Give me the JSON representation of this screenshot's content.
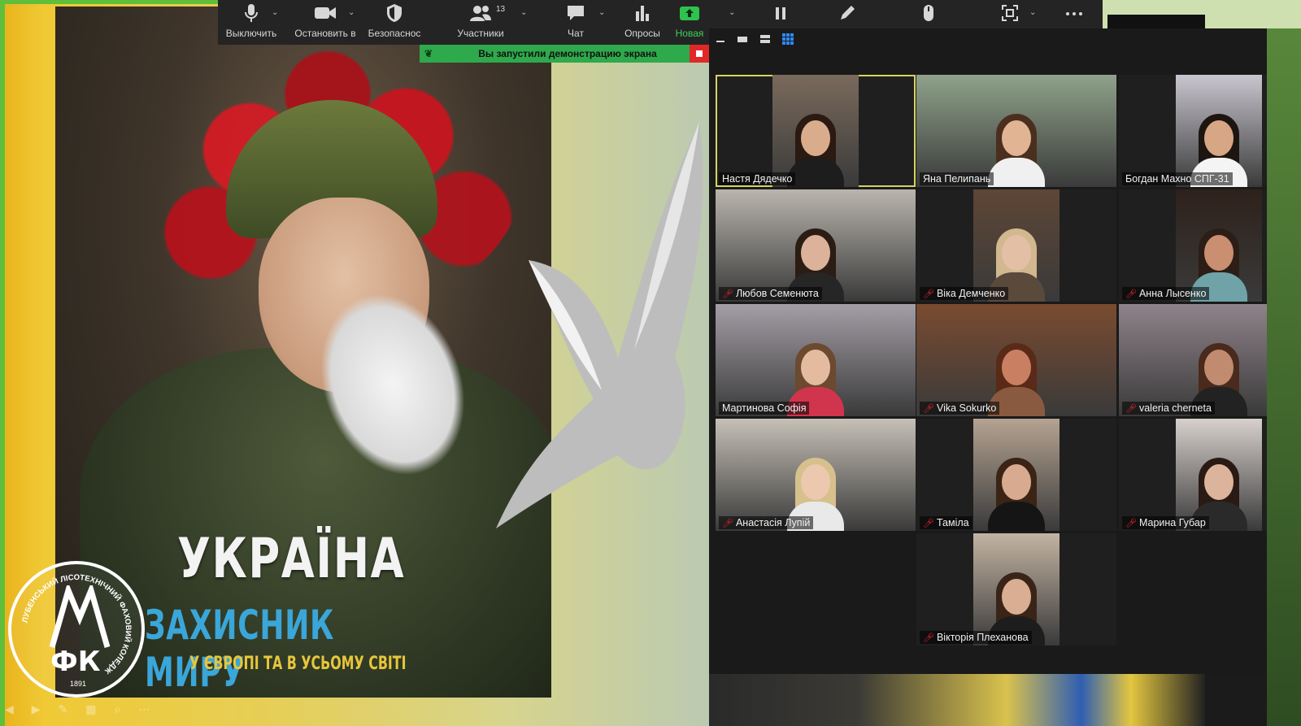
{
  "toolbar": {
    "mute": "Выключить",
    "stop_video": "Остановить в",
    "security": "Безопаснос",
    "participants": "Участники",
    "participants_count": "13",
    "chat": "Чат",
    "polls": "Опросы",
    "new_share": "Новая"
  },
  "share_banner": {
    "text": "Вы запустили демонстрацию экрана"
  },
  "colors": {
    "share_green": "#2ea94b",
    "stop_red": "#e02828",
    "active_speaker": "#d6d461",
    "mic_muted": "#e0262b"
  },
  "slide": {
    "title": "УКРАЇНА",
    "subtitle": "ЗАХИСНИК МИРУ",
    "tagline": "У ЄВРОПІ ТА В УСЬОМУ СВІТІ",
    "logo_letters": "ФК",
    "logo_ring": "ЛУБЕНСЬКИЙ ЛІСОТЕХНІЧНИЙ ФАХОВИЙ КОЛЕДЖ",
    "logo_year": "1891"
  },
  "participants": [
    {
      "name": "Настя Дядечко",
      "muted": false,
      "active": true
    },
    {
      "name": "Яна Пелипань",
      "muted": false,
      "active": false
    },
    {
      "name": "Богдан Махно СПГ-31",
      "muted": false,
      "active": false
    },
    {
      "name": "Любов Семенюта",
      "muted": true,
      "active": false
    },
    {
      "name": "Віка Демченко",
      "muted": true,
      "active": false
    },
    {
      "name": "Анна Лысенко",
      "muted": true,
      "active": false
    },
    {
      "name": "Мартинова Софія",
      "muted": false,
      "active": false
    },
    {
      "name": "Vika Sokurko",
      "muted": true,
      "active": false
    },
    {
      "name": "valeria cherneta",
      "muted": true,
      "active": false
    },
    {
      "name": "Анастасія Лупій",
      "muted": true,
      "active": false
    },
    {
      "name": "Таміла",
      "muted": true,
      "active": false
    },
    {
      "name": "Марина Губар",
      "muted": true,
      "active": false
    },
    {
      "name": "Вікторія Плеханова",
      "muted": true,
      "active": false
    }
  ]
}
